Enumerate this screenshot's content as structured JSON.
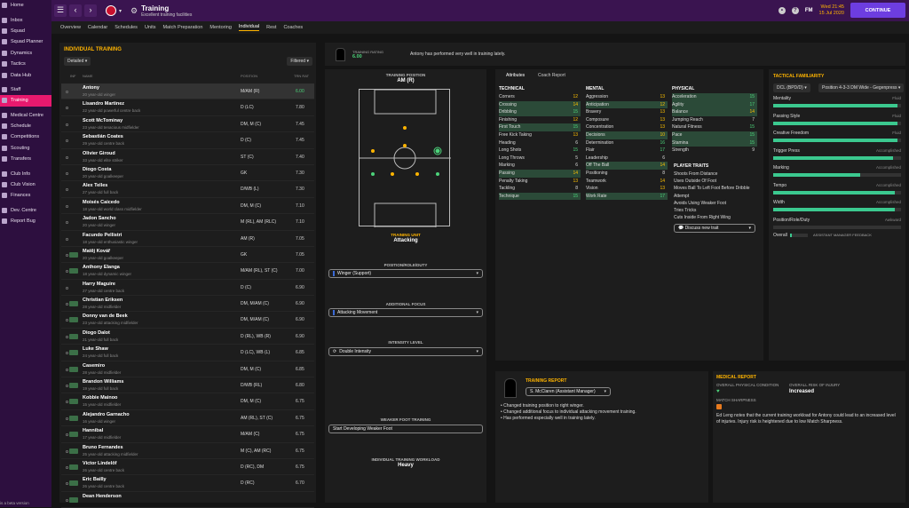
{
  "sidebar": {
    "items": [
      {
        "label": "Home"
      },
      {
        "label": "Inbox"
      },
      {
        "label": "Squad"
      },
      {
        "label": "Squad Planner"
      },
      {
        "label": "Dynamics"
      },
      {
        "label": "Tactics"
      },
      {
        "label": "Data Hub"
      },
      {
        "label": "Staff"
      },
      {
        "label": "Training"
      },
      {
        "label": "Medical Centre"
      },
      {
        "label": "Schedule"
      },
      {
        "label": "Competitions"
      },
      {
        "label": "Scouting"
      },
      {
        "label": "Transfers"
      },
      {
        "label": "Club Info"
      },
      {
        "label": "Club Vision"
      },
      {
        "label": "Finances"
      },
      {
        "label": "Dev. Centre"
      },
      {
        "label": "Report Bug"
      }
    ],
    "active_index": 8,
    "beta_text": "is a beta version"
  },
  "header": {
    "title": "Training",
    "subtitle": "Excellent training facilities",
    "fm_label": "FM",
    "date_line1": "Wed 21:45",
    "date_line2": "15 Jul 2020",
    "continue_label": "CONTINUE",
    "help_label": "?"
  },
  "subnav": {
    "tabs": [
      "Overview",
      "Calendar",
      "Schedules",
      "Units",
      "Match Preparation",
      "Mentoring",
      "Individual",
      "Rest",
      "Coaches"
    ],
    "active_index": 6
  },
  "individual": {
    "title": "INDIVIDUAL TRAINING",
    "view_dropdown": "Detailed",
    "filter_dropdown": "Filtered",
    "col_inf": "INF",
    "col_name": "NAME",
    "col_position": "POSITION",
    "col_rating": "TRN RAT",
    "players": [
      {
        "name": "Antony",
        "sub": "20 year-old winger",
        "pos": "M/AM (R)",
        "rating": "6.00"
      },
      {
        "name": "Lisandro Martinez",
        "sub": "22 year-old powerful centre back",
        "pos": "D (LC)",
        "rating": "7.80"
      },
      {
        "name": "Scott McTominay",
        "sub": "23 year-old tenacious midfielder",
        "pos": "DM, M (C)",
        "rating": "7.45"
      },
      {
        "name": "Sebastián Coates",
        "sub": "29 year-old centre back",
        "pos": "D (C)",
        "rating": "7.45"
      },
      {
        "name": "Olivier Giroud",
        "sub": "33 year-old elite striker",
        "pos": "ST (C)",
        "rating": "7.40"
      },
      {
        "name": "Diogo Costa",
        "sub": "20 year-old goalkeeper",
        "pos": "GK",
        "rating": "7.30"
      },
      {
        "name": "Alex Telles",
        "sub": "27 year-old full back",
        "pos": "D/WB (L)",
        "rating": "7.30"
      },
      {
        "name": "Moisés Caicedo",
        "sub": "18 year-old world class midfielder",
        "pos": "DM, M (C)",
        "rating": "7.10"
      },
      {
        "name": "Jadon Sancho",
        "sub": "20 year-old winger",
        "pos": "M (RL), AM (RLC)",
        "rating": "7.10"
      },
      {
        "name": "Facundo Pellistri",
        "sub": "18 year-old enthusiastic winger",
        "pos": "AM (R)",
        "rating": "7.05"
      },
      {
        "name": "Matěj Kovář",
        "sub": "20 year-old goalkeeper",
        "pos": "GK",
        "rating": "7.05"
      },
      {
        "name": "Anthony Elanga",
        "sub": "18 year-old dynamic winger",
        "pos": "M/AM (RL), ST (C)",
        "rating": "7.00"
      },
      {
        "name": "Harry Maguire",
        "sub": "27 year-old centre back",
        "pos": "D (C)",
        "rating": "6.90"
      },
      {
        "name": "Christian Eriksen",
        "sub": "28 year-old midfielder",
        "pos": "DM, M/AM (C)",
        "rating": "6.90"
      },
      {
        "name": "Donny van de Beek",
        "sub": "23 year-old attacking midfielder",
        "pos": "DM, M/AM (C)",
        "rating": "6.90"
      },
      {
        "name": "Diogo Dalot",
        "sub": "21 year-old full back",
        "pos": "D (RL), WB (R)",
        "rating": "6.90"
      },
      {
        "name": "Luke Shaw",
        "sub": "24 year-old full back",
        "pos": "D (LC), WB (L)",
        "rating": "6.85"
      },
      {
        "name": "Casemiro",
        "sub": "28 year-old midfielder",
        "pos": "DM, M (C)",
        "rating": "6.85"
      },
      {
        "name": "Brandon Williams",
        "sub": "19 year-old full back",
        "pos": "D/WB (RL)",
        "rating": "6.80"
      },
      {
        "name": "Kobbie Mainoo",
        "sub": "15 year-old midfielder",
        "pos": "DM, M (C)",
        "rating": "6.75"
      },
      {
        "name": "Alejandro Garnacho",
        "sub": "16 year-old winger",
        "pos": "AM (RL), ST (C)",
        "rating": "6.75"
      },
      {
        "name": "Hannibal",
        "sub": "17 year-old midfielder",
        "pos": "M/AM (C)",
        "rating": "6.75"
      },
      {
        "name": "Bruno Fernandes",
        "sub": "25 year-old attacking midfielder",
        "pos": "M (C), AM (RC)",
        "rating": "6.75"
      },
      {
        "name": "Victor Lindelöf",
        "sub": "26 year-old centre back",
        "pos": "D (RC), DM",
        "rating": "6.75"
      },
      {
        "name": "Eric Bailly",
        "sub": "26 year-old centre back",
        "pos": "D (RC)",
        "rating": "6.70"
      },
      {
        "name": "Dean Henderson",
        "sub": "",
        "pos": "",
        "rating": ""
      }
    ]
  },
  "info_bar": {
    "rating_label": "TRAINING RATING",
    "rating_value": "6.00",
    "message": "Antony has performed very well in training lately."
  },
  "training": {
    "position_label": "TRAINING POSITION",
    "position_value": "AM (R)",
    "unit_label": "TRAINING UNIT",
    "unit_value": "Attacking",
    "role_label": "POSITION/ROLE/DUTY",
    "role_value": "Winger (Support)",
    "focus_label": "ADDITIONAL FOCUS",
    "focus_value": "Attacking Movement",
    "intensity_label": "INTENSITY LEVEL",
    "intensity_value": "Double Intensity",
    "weakfoot_label": "WEAKER FOOT TRAINING",
    "weakfoot_value": "Start Developing Weaker Foot",
    "workload_label": "INDIVIDUAL TRAINING WORKLOAD",
    "workload_value": "Heavy"
  },
  "attributes": {
    "tabs": [
      "Attributes",
      "Coach Report"
    ],
    "technical_header": "TECHNICAL",
    "mental_header": "MENTAL",
    "physical_header": "PHYSICAL",
    "technical": [
      {
        "n": "Corners",
        "v": "12"
      },
      {
        "n": "Crossing",
        "v": "14"
      },
      {
        "n": "Dribbling",
        "v": "15"
      },
      {
        "n": "Finishing",
        "v": "12"
      },
      {
        "n": "First Touch",
        "v": "15"
      },
      {
        "n": "Free Kick Taking",
        "v": "13"
      },
      {
        "n": "Heading",
        "v": "6"
      },
      {
        "n": "Long Shots",
        "v": "15"
      },
      {
        "n": "Long Throws",
        "v": "5"
      },
      {
        "n": "Marking",
        "v": "6"
      },
      {
        "n": "Passing",
        "v": "14"
      },
      {
        "n": "Penalty Taking",
        "v": "13"
      },
      {
        "n": "Tackling",
        "v": "8"
      },
      {
        "n": "Technique",
        "v": "15"
      }
    ],
    "mental": [
      {
        "n": "Aggression",
        "v": "13"
      },
      {
        "n": "Anticipation",
        "v": "12"
      },
      {
        "n": "Bravery",
        "v": "13"
      },
      {
        "n": "Composure",
        "v": "13"
      },
      {
        "n": "Concentration",
        "v": "13"
      },
      {
        "n": "Decisions",
        "v": "10"
      },
      {
        "n": "Determination",
        "v": "16"
      },
      {
        "n": "Flair",
        "v": "17"
      },
      {
        "n": "Leadership",
        "v": "6"
      },
      {
        "n": "Off The Ball",
        "v": "14"
      },
      {
        "n": "Positioning",
        "v": "8"
      },
      {
        "n": "Teamwork",
        "v": "14"
      },
      {
        "n": "Vision",
        "v": "13"
      },
      {
        "n": "Work Rate",
        "v": "17"
      }
    ],
    "physical": [
      {
        "n": "Acceleration",
        "v": "15"
      },
      {
        "n": "Agility",
        "v": "17"
      },
      {
        "n": "Balance",
        "v": "14"
      },
      {
        "n": "Jumping Reach",
        "v": "7"
      },
      {
        "n": "Natural Fitness",
        "v": "15"
      },
      {
        "n": "Pace",
        "v": "15"
      },
      {
        "n": "Stamina",
        "v": "15"
      },
      {
        "n": "Strength",
        "v": "9"
      }
    ],
    "traits_header": "PLAYER TRAITS",
    "traits": [
      "Shoots From Distance",
      "Uses Outside Of Foot",
      "Moves Ball To Left Foot Before Dribble",
      "Attempt",
      "Avoids Using Weaker Foot",
      "Tries Tricks",
      "Cuts Inside From Right Wing"
    ],
    "discuss_label": "Discuss new trait"
  },
  "tactical": {
    "title": "TACTICAL FAMILIARITY",
    "dd1": "DCL (BPD/D)",
    "dd2": "Position 4-3-3 DM Wide - Gegenpress",
    "rows": [
      {
        "k": "Mentality",
        "l": "Fluid",
        "v": 0.97
      },
      {
        "k": "Passing Style",
        "l": "Fluid",
        "v": 0.97
      },
      {
        "k": "Creative Freedom",
        "l": "Fluid",
        "v": 0.97
      },
      {
        "k": "Trigger Press",
        "l": "Accomplished",
        "v": 0.94
      },
      {
        "k": "Marking",
        "l": "Accomplished",
        "v": 0.68
      },
      {
        "k": "Tempo",
        "l": "Accomplished",
        "v": 0.95
      },
      {
        "k": "Width",
        "l": "Accomplished",
        "v": 0.95
      },
      {
        "k": "Position/Role/Duty",
        "l": "Awkward",
        "v": 0.0
      }
    ],
    "overall_label": "Overall",
    "overall_value": 0.1,
    "assistant_label": "ASSISTANT MANAGER FEEDBACK"
  },
  "report": {
    "title": "TRAINING REPORT",
    "coach": "S. McClaren (Assistant Manager)",
    "bullets": [
      "Changed training position to right winger.",
      "Changed additional focus to individual attacking movement training.",
      "Has performed especially well in training lately."
    ]
  },
  "medical": {
    "title": "MEDICAL REPORT",
    "cond_label": "OVERALL PHYSICAL CONDITION",
    "risk_label": "OVERALL RISK OF INJURY",
    "risk_value": "Increased",
    "sharp_label": "MATCH SHARPNESS",
    "note": "Ed Leng notes that the current training workload for Antony could lead to an increased level of injuries. Injury risk is heightened due to low Match Sharpness."
  },
  "colors": {
    "accent": "#e8196e",
    "gold": "#ffb400",
    "purple": "#3a1450",
    "green": "#4cd37a"
  }
}
